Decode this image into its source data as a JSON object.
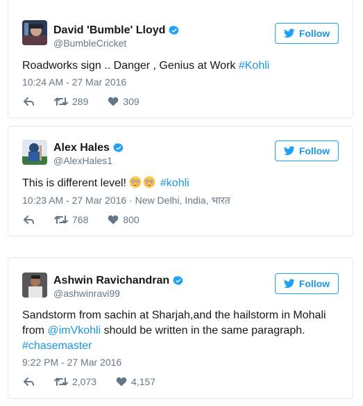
{
  "follow_label": "Follow",
  "colors": {
    "link": "#1b95e0",
    "verified": "#1da1f2",
    "text": "#14171a",
    "meta": "#657786",
    "border": "#e1e8ed"
  },
  "tweets": [
    {
      "name": "David 'Bumble' Lloyd",
      "handle": "@BumbleCricket",
      "text": "Roadworks sign .. Danger , Genius at Work ",
      "hashtag": "#Kohli",
      "timestamp": "10:24 AM - 27 Mar 2016",
      "retweets": "289",
      "likes": "309"
    },
    {
      "name": "Alex Hales",
      "handle": "@AlexHales1",
      "text": "This is different level! ",
      "emoji": [
        "flushed-face",
        "flushed-face"
      ],
      "hashtag": "#kohli",
      "timestamp": "10:23 AM - 27 Mar 2016",
      "location": "New Delhi, India, भारत",
      "retweets": "768",
      "likes": "800"
    },
    {
      "name": "Ashwin Ravichandran",
      "handle": "@ashwinravi99",
      "text_line1": "Sandstorm from sachin at Sharjah,and the hailstorm in Mohali",
      "text_from": "from ",
      "mention": "@imVkohli",
      "text_line2_rest": " should be written in the same paragraph.",
      "hashtag": "#chasemaster",
      "timestamp": "9:22 PM - 27 Mar 2016",
      "retweets": "2,073",
      "likes": "4,157"
    }
  ],
  "icons": {
    "verified": "verified-badge-icon",
    "twitter": "twitter-bird-icon",
    "reply": "reply-icon",
    "retweet": "retweet-icon",
    "like": "heart-icon"
  }
}
